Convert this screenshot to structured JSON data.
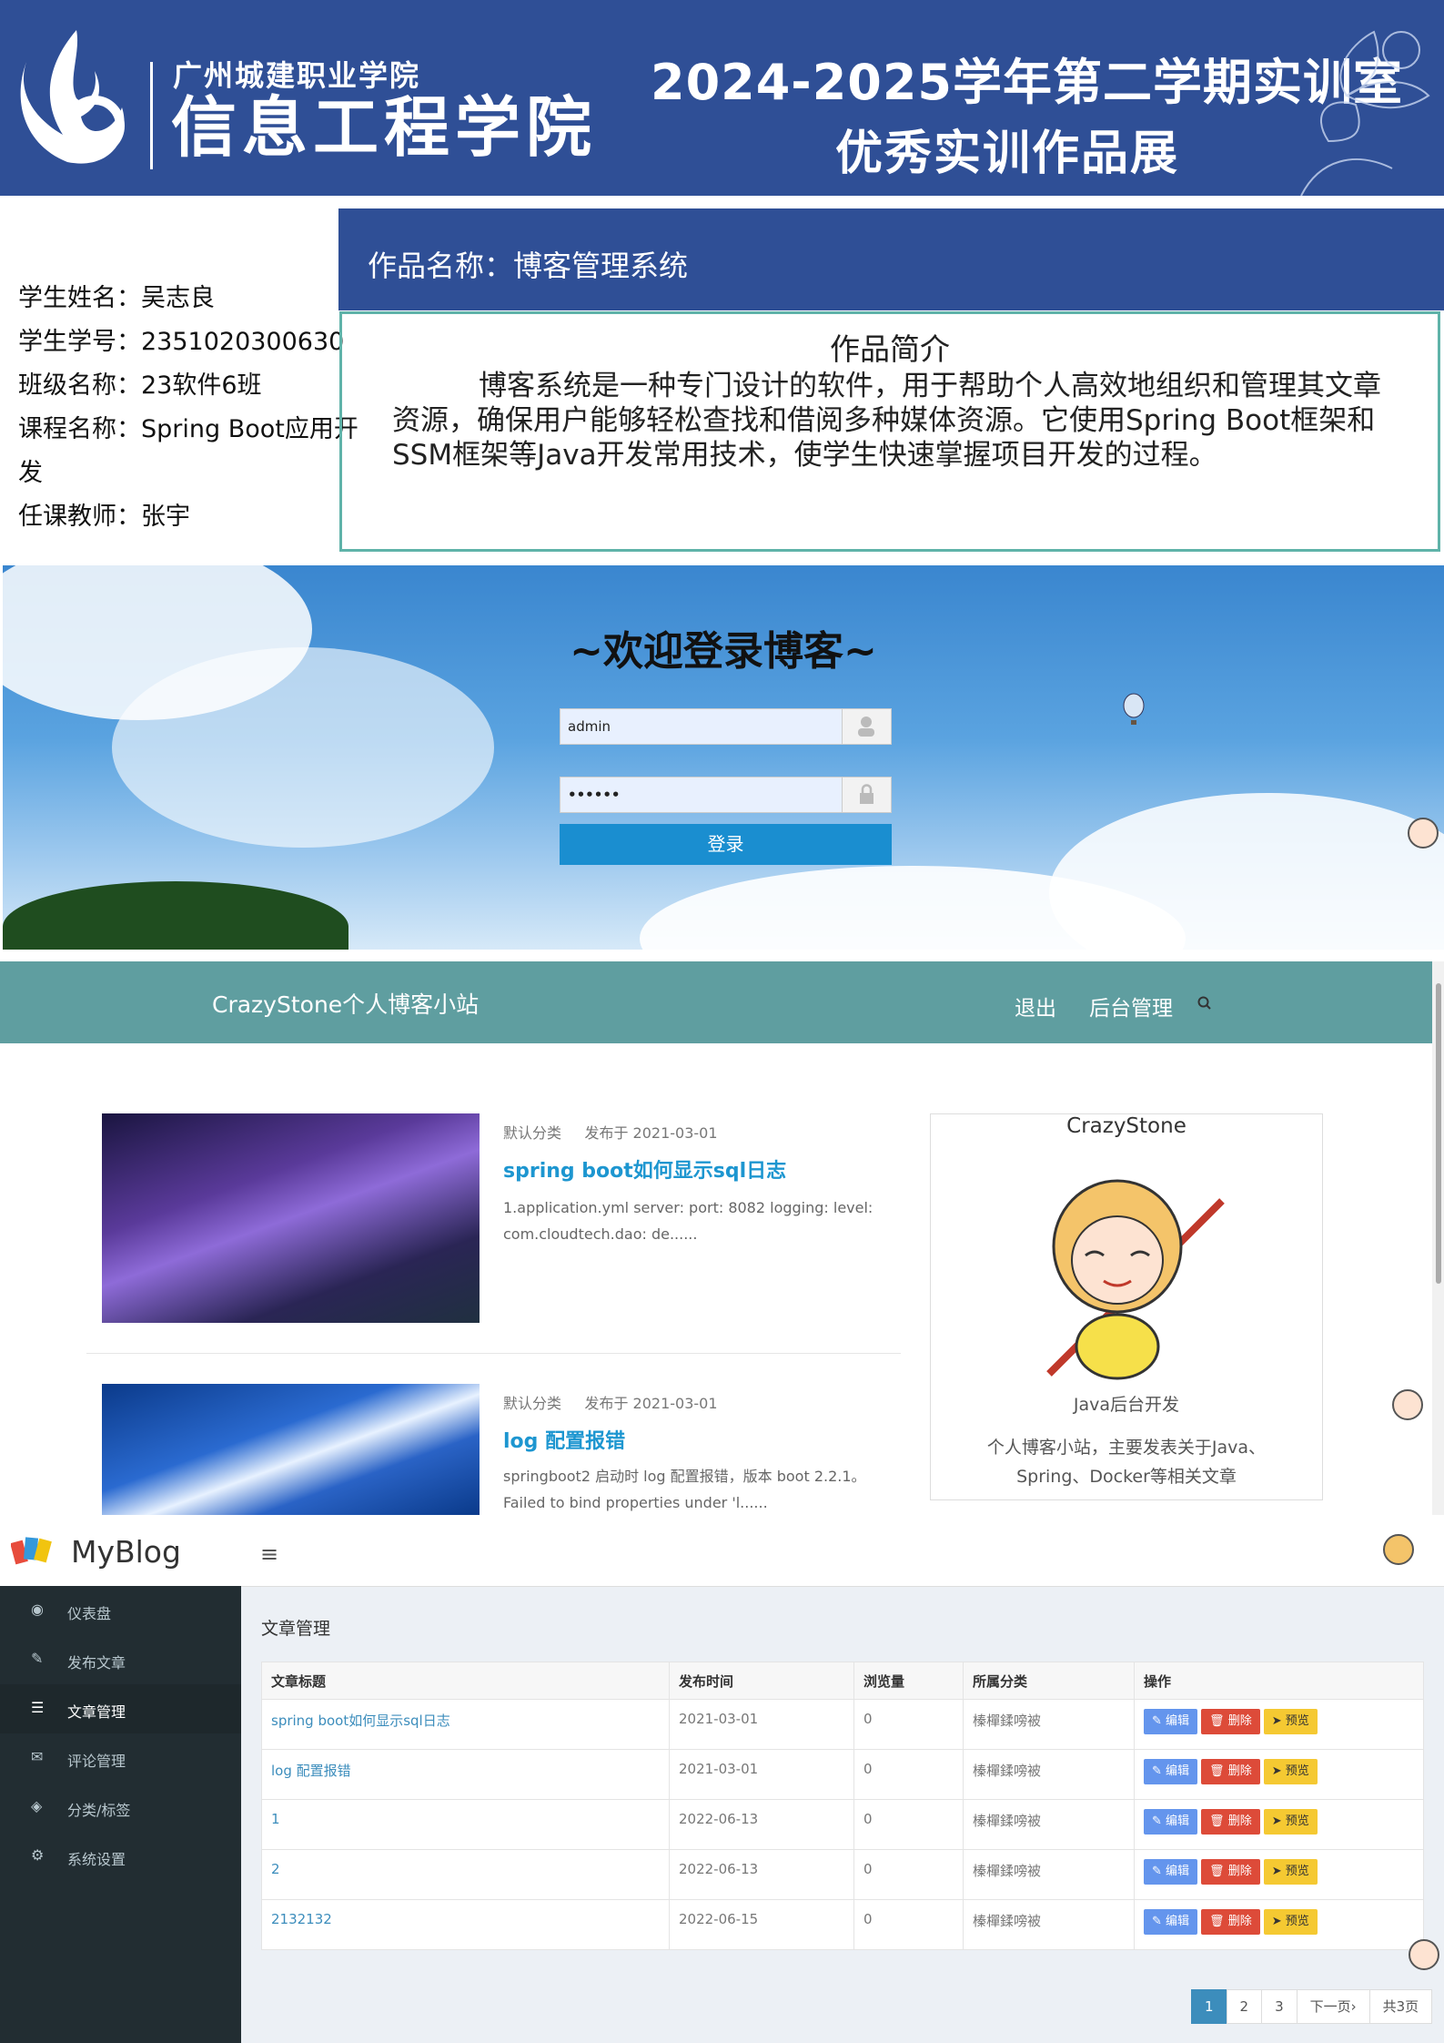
{
  "header": {
    "school": "广州城建职业学院",
    "college": "信息工程学院",
    "title_line1": "2024-2025学年第二学期实训室",
    "title_line2": "优秀实训作品展",
    "bg_color": "#2f4f96"
  },
  "student": {
    "name": "学生姓名：吴志良",
    "id": "学生学号：2351020300630",
    "class": "班级名称：23软件6班",
    "course_line1": "课程名称：Spring Boot应用开",
    "course_line2": "发",
    "teacher": "任课教师：张宇"
  },
  "work": {
    "name": "作品名称：博客管理系统",
    "intro_heading": "作品简介",
    "intro_text": "博客系统是一种专门设计的软件，用于帮助个人高效地组织和管理其文章资源，确保用户能够轻松查找和借阅多种媒体资源。它使用Spring Boot框架和SSM框架等Java开发常用技术，使学生快速掌握项目开发的过程。"
  },
  "login": {
    "welcome": "~欢迎登录博客~",
    "username_value": "admin",
    "password_value": "••••••",
    "login_button": "登录"
  },
  "blog": {
    "brand": "CrazyStone个人博客小站",
    "nav_logout": "退出",
    "nav_admin": "后台管理",
    "articles": [
      {
        "category": "默认分类",
        "date": "发布于 2021-03-01",
        "title": "spring boot如何显示sql日志",
        "excerpt": "1.application.yml server: port: 8082 logging: level: com.cloudtech.dao: de......"
      },
      {
        "category": "默认分类",
        "date": "发布于 2021-03-01",
        "title": "log 配置报错",
        "excerpt": "springboot2 启动时 log 配置报错，版本 boot 2.2.1。 Failed to bind properties under 'l......"
      }
    ],
    "profile": {
      "name": "CrazyStone",
      "role": "Java后台开发",
      "desc": "个人博客小站，主要发表关于Java、Spring、Docker等相关文章"
    }
  },
  "admin": {
    "logo": "MyBlog",
    "sidebar": [
      "仪表盘",
      "发布文章",
      "文章管理",
      "评论管理",
      "分类/标签",
      "系统设置"
    ],
    "page_title": "文章管理",
    "columns": [
      "文章标题",
      "发布时间",
      "浏览量",
      "所属分类",
      "操作"
    ],
    "rows": [
      {
        "title": "spring boot如何显示sql日志",
        "date": "2021-03-01",
        "views": "0",
        "category": "榛樿鍒嗙被"
      },
      {
        "title": "log 配置报错",
        "date": "2021-03-01",
        "views": "0",
        "category": "榛樿鍒嗙被"
      },
      {
        "title": "1",
        "date": "2022-06-13",
        "views": "0",
        "category": "榛樿鍒嗙被"
      },
      {
        "title": "2",
        "date": "2022-06-13",
        "views": "0",
        "category": "榛樿鍒嗙被"
      },
      {
        "title": "2132132",
        "date": "2022-06-15",
        "views": "0",
        "category": "榛樿鍒嗙被"
      }
    ],
    "actions": {
      "edit": "编辑",
      "delete": "删除",
      "preview": "预览"
    },
    "pager": [
      "1",
      "2",
      "3",
      "下一页›",
      "共3页"
    ]
  }
}
